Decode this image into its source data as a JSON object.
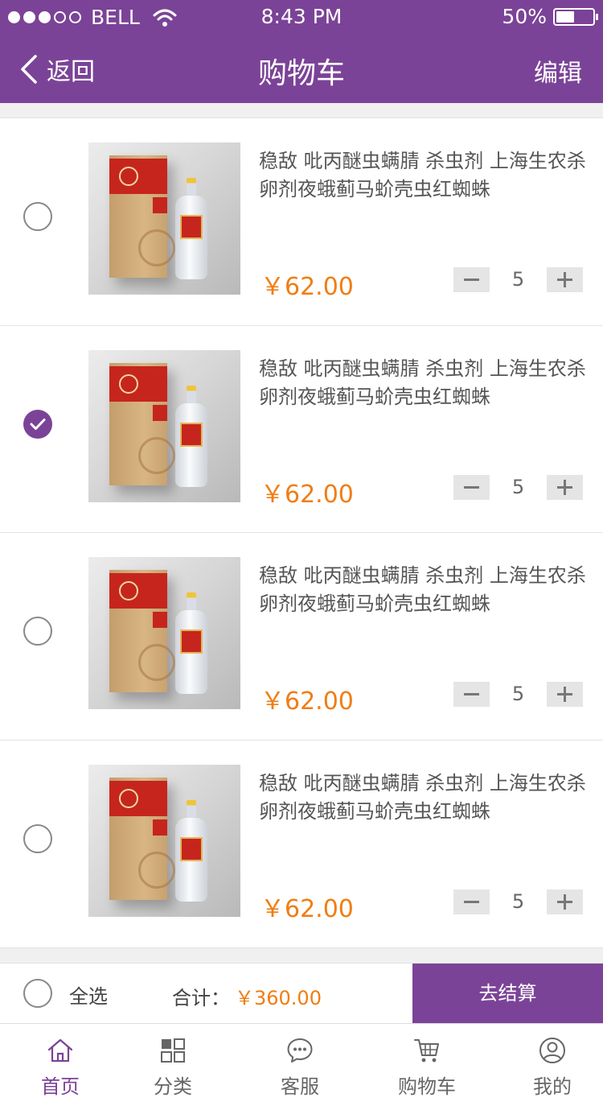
{
  "status_bar": {
    "carrier": "BELL",
    "time": "8:43 PM",
    "battery": "50%",
    "battery_level": 0.5,
    "signal_bars_filled": 3,
    "signal_bars_total": 5
  },
  "navbar": {
    "back_label": "返回",
    "title": "购物车",
    "edit_label": "编辑"
  },
  "colors": {
    "brand": "#7b4397",
    "price": "#f07d12"
  },
  "cart": {
    "items": [
      {
        "title": "稳敌 吡丙醚虫螨腈 杀虫剂 上海生农杀卵剂夜蛾蓟马蚧壳虫红蜘蛛",
        "price": "￥62.00",
        "quantity": "5",
        "checked": false
      },
      {
        "title": "稳敌 吡丙醚虫螨腈 杀虫剂 上海生农杀卵剂夜蛾蓟马蚧壳虫红蜘蛛",
        "price": "￥62.00",
        "quantity": "5",
        "checked": true
      },
      {
        "title": "稳敌 吡丙醚虫螨腈 杀虫剂 上海生农杀卵剂夜蛾蓟马蚧壳虫红蜘蛛",
        "price": "￥62.00",
        "quantity": "5",
        "checked": false
      },
      {
        "title": "稳敌 吡丙醚虫螨腈 杀虫剂 上海生农杀卵剂夜蛾蓟马蚧壳虫红蜘蛛",
        "price": "￥62.00",
        "quantity": "5",
        "checked": false
      }
    ]
  },
  "footer": {
    "select_all_label": "全选",
    "total_label": "合计：",
    "total_value": "￥360.00",
    "checkout_label": "去结算"
  },
  "tabbar": {
    "tabs": [
      {
        "label": "首页",
        "icon": "home-icon",
        "active": true
      },
      {
        "label": "分类",
        "icon": "category-grid-icon",
        "active": false
      },
      {
        "label": "客服",
        "icon": "chat-bubble-icon",
        "active": false
      },
      {
        "label": "购物车",
        "icon": "cart-icon",
        "active": false
      },
      {
        "label": "我的",
        "icon": "user-icon",
        "active": false
      }
    ]
  }
}
